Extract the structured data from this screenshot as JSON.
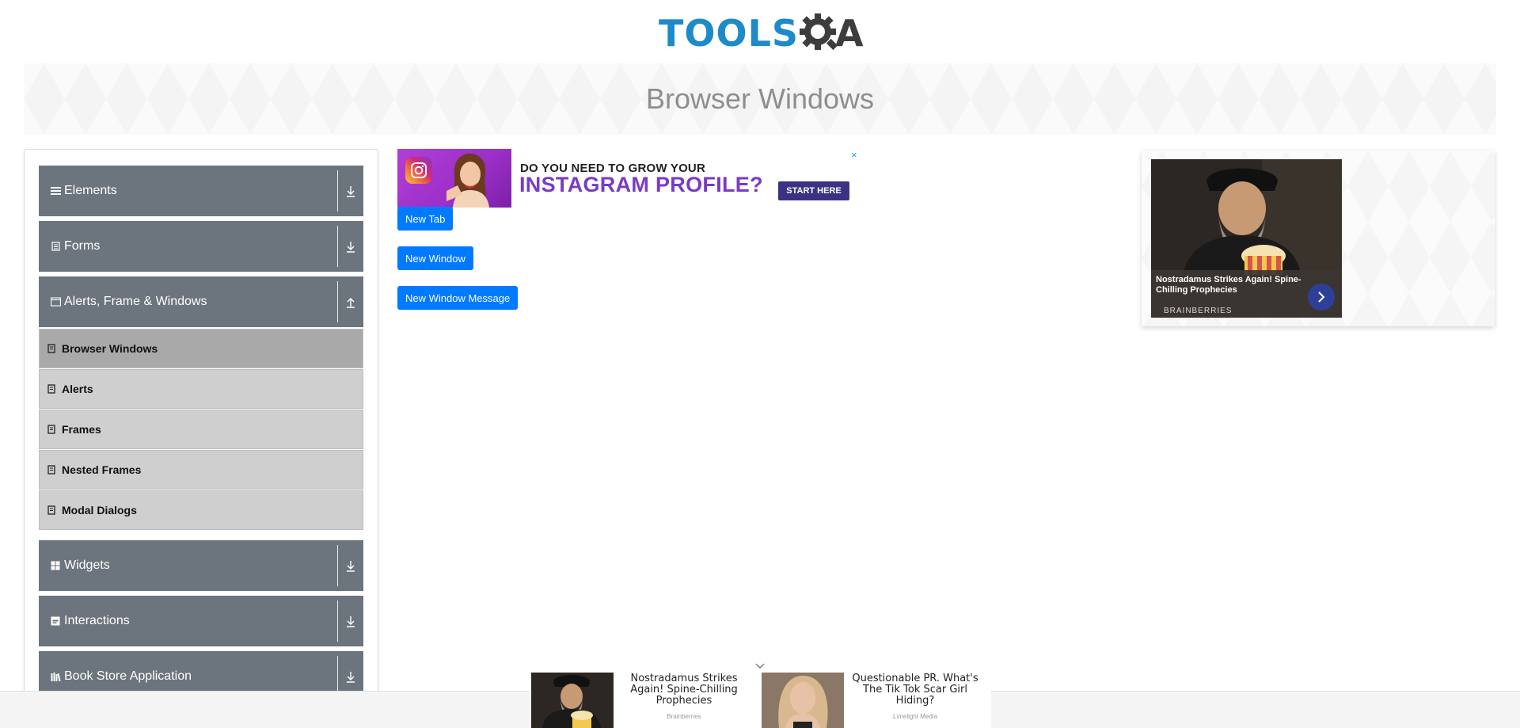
{
  "header": {
    "logo_text": "TOOLS",
    "logo_suffix": "A"
  },
  "banner": {
    "title": "Browser Windows"
  },
  "sidebar": {
    "groups": [
      {
        "label": "Elements",
        "icon": "hamburger-icon",
        "state": "collapsed"
      },
      {
        "label": "Forms",
        "icon": "form-icon",
        "state": "collapsed"
      },
      {
        "label": "Alerts, Frame & Windows",
        "icon": "window-icon",
        "state": "expanded",
        "items": [
          {
            "label": "Browser Windows",
            "active": true
          },
          {
            "label": "Alerts",
            "active": false
          },
          {
            "label": "Frames",
            "active": false
          },
          {
            "label": "Nested Frames",
            "active": false
          },
          {
            "label": "Modal Dialogs",
            "active": false
          }
        ]
      },
      {
        "label": "Widgets",
        "icon": "widgets-icon",
        "state": "collapsed"
      },
      {
        "label": "Interactions",
        "icon": "interactions-icon",
        "state": "collapsed"
      },
      {
        "label": "Book Store Application",
        "icon": "bookstore-icon",
        "state": "collapsed"
      }
    ]
  },
  "ad_banner": {
    "line1": "DO YOU NEED TO GROW YOUR",
    "line2": "INSTAGRAM PROFILE?",
    "cta": "START HERE",
    "close": "×"
  },
  "buttons": {
    "new_tab": "New Tab",
    "new_window": "New Window",
    "new_window_message": "New Window Message"
  },
  "right_ad": {
    "title": "Nostradamus Strikes Again! Spine-Chilling Prophecies",
    "source": "BRAINBERRIES"
  },
  "bottom_ads": [
    {
      "title": "Nostradamus Strikes Again! Spine-Chilling Prophecies",
      "source": "Brainberries"
    },
    {
      "title": "Questionable PR. What's The Tik Tok Scar Girl Hiding?",
      "source": "Limelight Media"
    }
  ],
  "colors": {
    "sidebar_header": "#6c757d",
    "sub_item": "#cfcfcf",
    "sub_item_active": "#a9a9a9",
    "primary_button": "#007bff",
    "logo_blue": "#1d8ac9"
  }
}
